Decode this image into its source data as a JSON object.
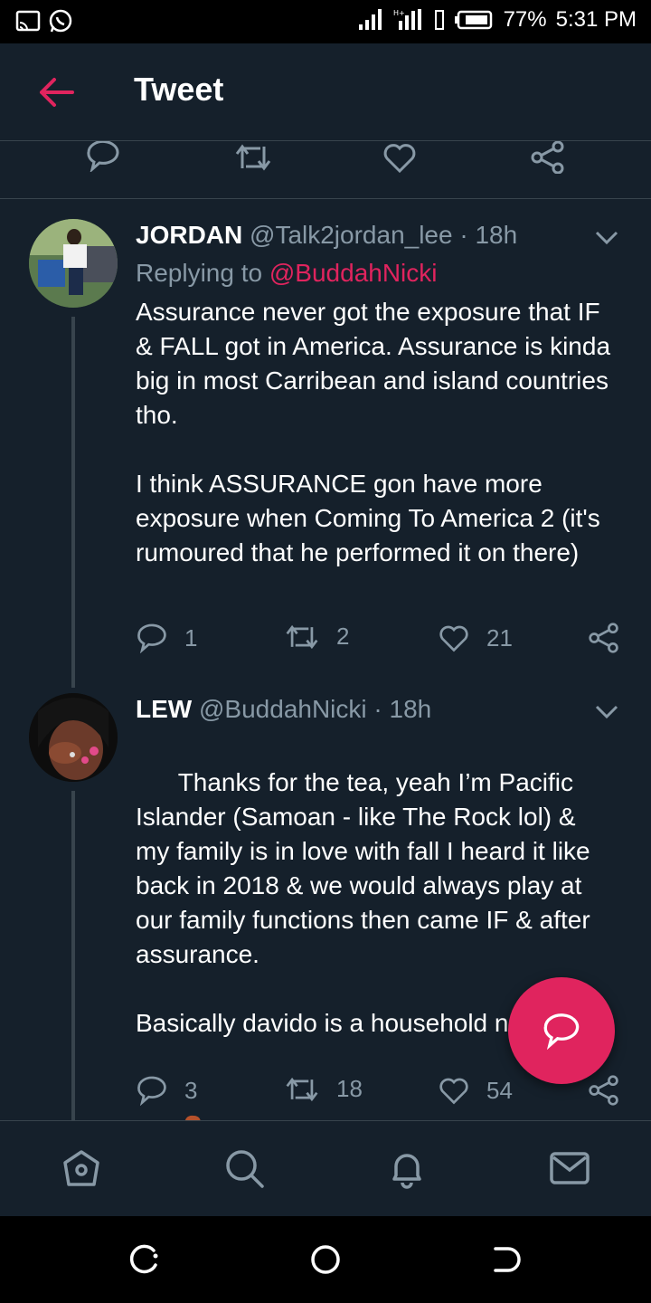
{
  "status_bar": {
    "battery": "77%",
    "time": "5:31 PM",
    "icons": [
      "cast-icon",
      "whatsapp-icon",
      "signal-icon",
      "signal-4g-icon",
      "vibrate-icon",
      "battery-icon"
    ]
  },
  "header": {
    "title": "Tweet"
  },
  "tweets": [
    {
      "name": "JORDAN",
      "handle": "@Talk2jordan_lee",
      "time": "· 18h",
      "replying_prefix": "Replying to ",
      "replying_to": "@BuddahNicki",
      "text": "Assurance never got the exposure that IF & FALL got in America. Assurance is kinda big in most Carribean and island countries tho.\n\nI think ASSURANCE gon have more exposure when Coming To America 2 (it's rumoured that he performed it on there)",
      "replies": "1",
      "retweets": "2",
      "likes": "21"
    },
    {
      "name": "LEW",
      "handle": "@BuddahNicki",
      "time": "· 18h",
      "text": "Thanks for the tea, yeah I’m Pacific Islander (Samoan - like The Rock lol) & my family is in love with fall I heard it like back in 2018 & we would always play at our family functions then came IF & after assurance.\n\nBasically davido is a household n",
      "replies": "3",
      "retweets": "18",
      "likes": "54"
    }
  ],
  "colors": {
    "background": "#15202b",
    "accent": "#e0245e",
    "muted": "#8899a6",
    "divider": "#38444d"
  }
}
